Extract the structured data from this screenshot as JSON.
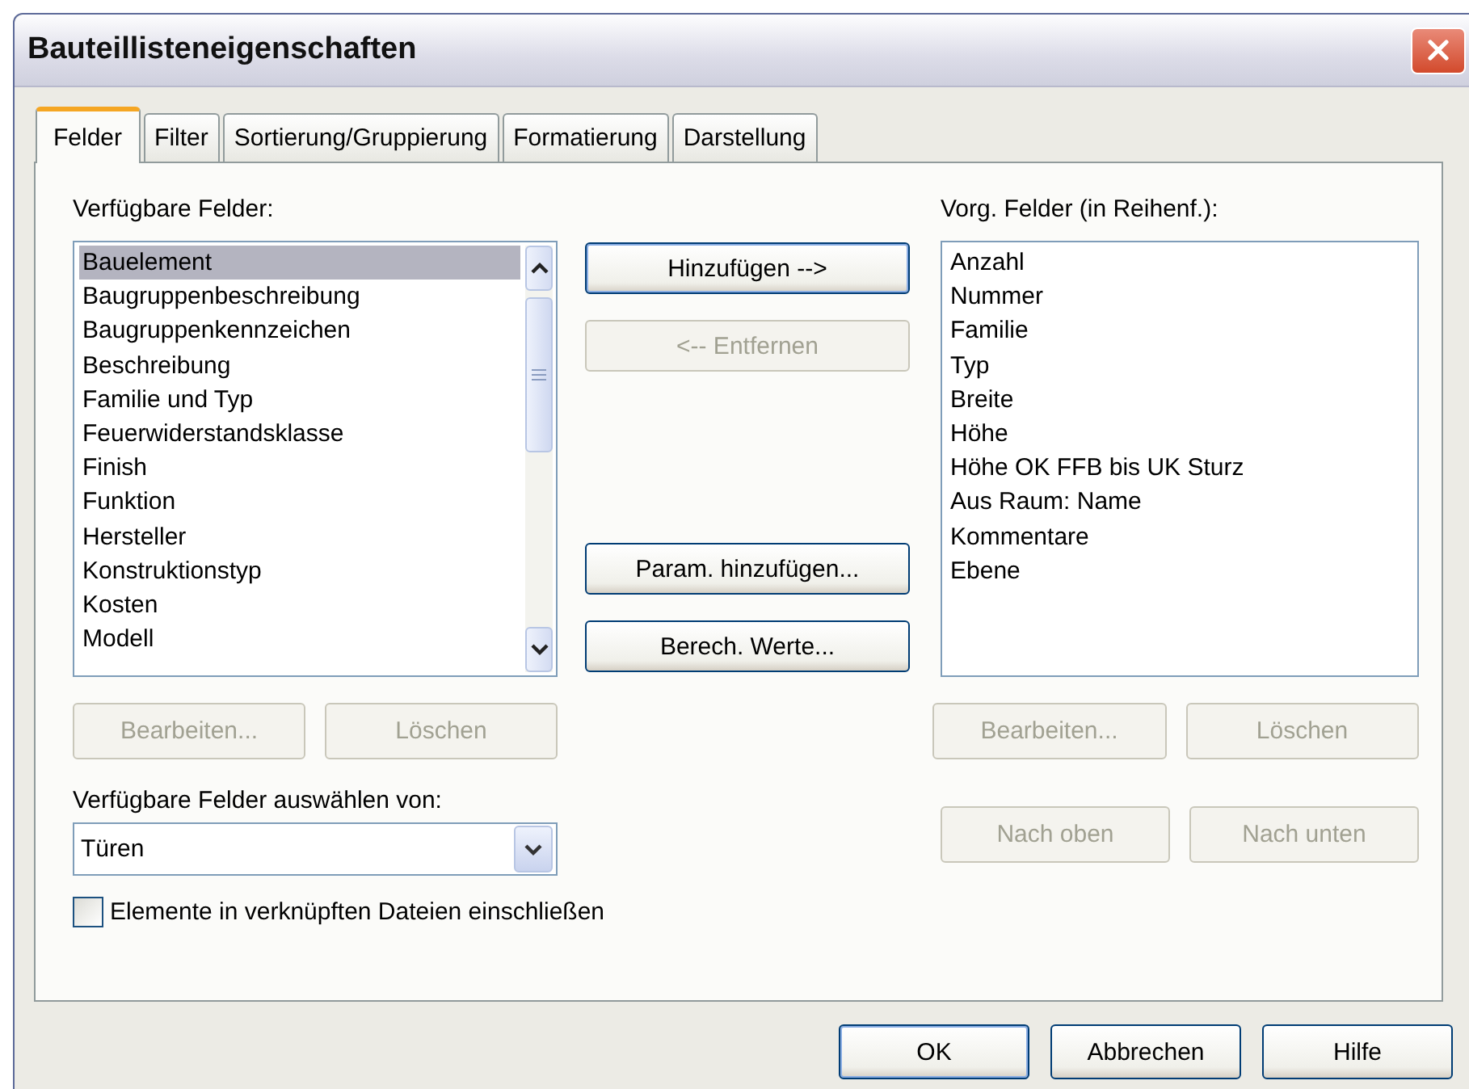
{
  "window": {
    "title": "Bauteillisteneigenschaften"
  },
  "tabs": [
    {
      "label": "Felder",
      "selected": true
    },
    {
      "label": "Filter",
      "selected": false
    },
    {
      "label": "Sortierung/Gruppierung",
      "selected": false
    },
    {
      "label": "Formatierung",
      "selected": false
    },
    {
      "label": "Darstellung",
      "selected": false
    }
  ],
  "available_fields": {
    "label": "Verfügbare Felder:",
    "items": [
      {
        "text": "Bauelement",
        "selected": true
      },
      {
        "text": "Baugruppenbeschreibung",
        "selected": false
      },
      {
        "text": "Baugruppenkennzeichen",
        "selected": false
      },
      {
        "text": "Beschreibung",
        "selected": false
      },
      {
        "text": "Familie und Typ",
        "selected": false
      },
      {
        "text": "Feuerwiderstandsklasse",
        "selected": false
      },
      {
        "text": "Finish",
        "selected": false
      },
      {
        "text": "Funktion",
        "selected": false
      },
      {
        "text": "Hersteller",
        "selected": false
      },
      {
        "text": "Konstruktionstyp",
        "selected": false
      },
      {
        "text": "Kosten",
        "selected": false
      },
      {
        "text": "Modell",
        "selected": false
      }
    ],
    "buttons": [
      {
        "label": "Bearbeiten...",
        "disabled": true
      },
      {
        "label": "Löschen",
        "disabled": true
      }
    ]
  },
  "middle_buttons": [
    {
      "label": "Hinzufügen -->",
      "disabled": false,
      "gap_before": false
    },
    {
      "label": "<-- Entfernen",
      "disabled": true,
      "gap_before": false
    },
    {
      "label": "Param. hinzufügen...",
      "disabled": false,
      "gap_before": true
    },
    {
      "label": "Berech. Werte...",
      "disabled": false,
      "gap_before": false
    }
  ],
  "scheduled_fields": {
    "label": "Vorg. Felder (in Reihenf.):",
    "items": [
      {
        "text": "Anzahl",
        "selected": false
      },
      {
        "text": "Nummer",
        "selected": false
      },
      {
        "text": "Familie",
        "selected": false
      },
      {
        "text": "Typ",
        "selected": false
      },
      {
        "text": "Breite",
        "selected": false
      },
      {
        "text": "Höhe",
        "selected": false
      },
      {
        "text": "Höhe OK FFB bis UK Sturz",
        "selected": false
      },
      {
        "text": "Aus Raum: Name",
        "selected": false
      },
      {
        "text": "Kommentare",
        "selected": false
      },
      {
        "text": "Ebene",
        "selected": false
      }
    ],
    "buttons": [
      {
        "label": "Bearbeiten...",
        "disabled": true
      },
      {
        "label": "Löschen",
        "disabled": true
      }
    ]
  },
  "select_from": {
    "label": "Verfügbare Felder auswählen von:",
    "value": "Türen"
  },
  "move_buttons": [
    {
      "label": "Nach oben",
      "disabled": true
    },
    {
      "label": "Nach unten",
      "disabled": true
    }
  ],
  "include_linked": {
    "label": "Elemente in verknüpften Dateien einschließen",
    "checked": false
  },
  "footer_buttons": [
    {
      "label": "OK",
      "disabled": false
    },
    {
      "label": "Abbrechen",
      "disabled": false
    },
    {
      "label": "Hilfe",
      "disabled": false
    }
  ]
}
